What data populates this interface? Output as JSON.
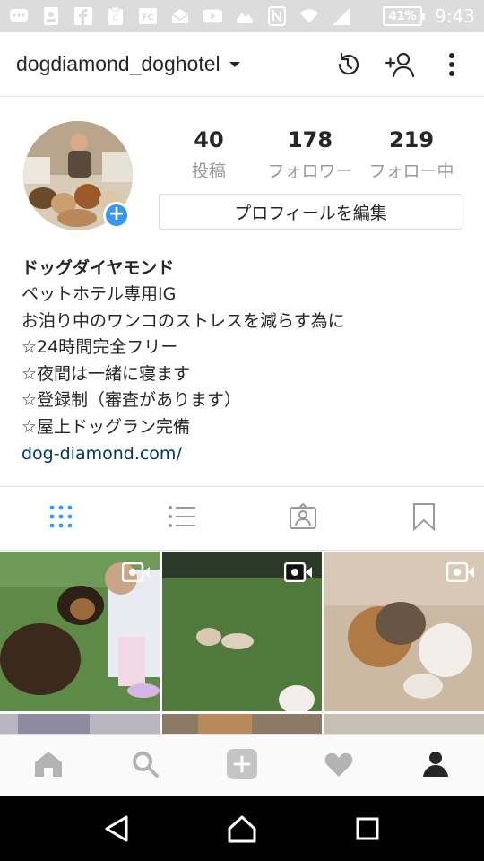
{
  "status_bar": {
    "icons": [
      "message-icon",
      "contact-card-icon",
      "facebook-icon",
      "clipboard-icon",
      "fc-app-icon",
      "mail-icon",
      "youtube-icon",
      "photo-icon",
      "nfc-icon",
      "wifi-icon",
      "signal-icon"
    ],
    "battery": "41%",
    "time": "9:43"
  },
  "top_bar": {
    "username": "dogdiamond_doghotel",
    "actions": [
      "history-icon",
      "add-person-icon",
      "more-icon"
    ]
  },
  "profile": {
    "stats": [
      {
        "value": "40",
        "label": "投稿"
      },
      {
        "value": "178",
        "label": "フォロワー"
      },
      {
        "value": "219",
        "label": "フォロー中"
      }
    ],
    "edit_button": "プロフィールを編集",
    "bio": {
      "name": "ドッグダイヤモンド",
      "lines": [
        "ペットホテル専用IG",
        "お泊り中のワンコのストレスを減らす為に",
        "☆24時間完全フリー",
        "☆夜間は一緒に寝ます",
        "☆登録制（審査があります）",
        "☆屋上ドッグラン完備"
      ],
      "link": "dog-diamond.com/"
    }
  },
  "view_tabs": [
    {
      "icon": "grid-icon",
      "active": true
    },
    {
      "icon": "list-icon",
      "active": false
    },
    {
      "icon": "tagged-icon",
      "active": false
    },
    {
      "icon": "saved-icon",
      "active": false
    }
  ],
  "bottom_nav": [
    "home-icon",
    "search-icon",
    "add-post-icon",
    "activity-icon",
    "profile-icon"
  ],
  "colors": {
    "accent": "#3897f0",
    "link": "#003569",
    "muted": "#999999",
    "grass": "#4d7a3a"
  }
}
